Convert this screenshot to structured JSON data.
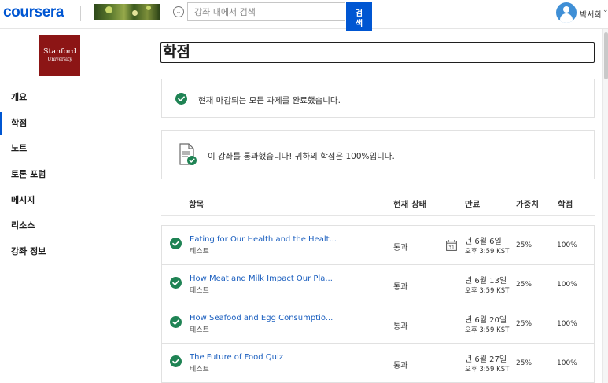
{
  "topbar": {
    "logo": "coursera",
    "search_placeholder": "강좌 내에서 검색",
    "search_button": "검\n색",
    "user_name": "박서희",
    "scope_icon": "chevron-down-icon",
    "user_chevron": "chevron-down-icon"
  },
  "sidebar": {
    "university_logo": {
      "line1": "Stanford",
      "line2": "University"
    },
    "items": [
      {
        "label": "개요",
        "active": false
      },
      {
        "label": "학점",
        "active": true
      },
      {
        "label": "노트",
        "active": false
      },
      {
        "label": "토론 포럼",
        "active": false
      },
      {
        "label": "메시지",
        "active": false
      },
      {
        "label": "리소스",
        "active": false
      },
      {
        "label": "강좌 정보",
        "active": false
      }
    ]
  },
  "main": {
    "title": "학점",
    "deadline_card": {
      "text": "현재 마감되는 모든 과제를 완료했습니다.",
      "icon": "check-circle-icon"
    },
    "pass_card": {
      "text": "이 강좌를 통과했습니다! 귀하의 학점은 100%입니다.",
      "icon": "document-check-icon"
    },
    "table": {
      "headers": {
        "item": "항목",
        "status": "현재 상태",
        "due": "만료",
        "weight": "가중치",
        "grade": "학점"
      },
      "rows": [
        {
          "title": "Eating for Our Health and the Healt...",
          "type": "테스트",
          "status": "통과",
          "due_date": "년 6월 6일",
          "due_time": "오후 3:59 KST",
          "weight": "25%",
          "grade": "100%",
          "show_calendar": true
        },
        {
          "title": "How Meat and Milk Impact Our Pla...",
          "type": "테스트",
          "status": "통과",
          "due_date": "년 6월 13일",
          "due_time": "오후 3:59 KST",
          "weight": "25%",
          "grade": "100%",
          "show_calendar": false
        },
        {
          "title": "How Seafood and Egg Consumptio...",
          "type": "테스트",
          "status": "통과",
          "due_date": "년 6월 20일",
          "due_time": "오후 3:59 KST",
          "weight": "25%",
          "grade": "100%",
          "show_calendar": false
        },
        {
          "title": "The Future of Food Quiz",
          "type": "테스트",
          "status": "통과",
          "due_date": "년 6월 27일",
          "due_time": "오후 3:59 KST",
          "weight": "25%",
          "grade": "100%",
          "show_calendar": false
        }
      ],
      "calendar_icon_text": "31"
    }
  },
  "colors": {
    "brand": "#0056d2",
    "success": "#1f8354",
    "stanford": "#8c1515",
    "link": "#1b5fbf"
  }
}
